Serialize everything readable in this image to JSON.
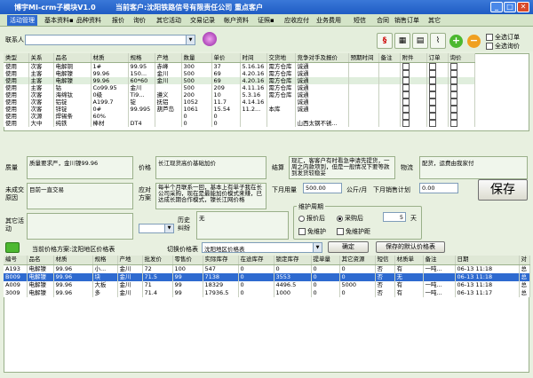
{
  "window": {
    "title": "博宇MI-crm子模块V1.0",
    "customer": "当前客户:沈阳铁路信号有限责任公司 重点客户"
  },
  "menu": [
    "活动管理",
    "基本资料▪",
    "品种资料",
    "报价",
    "询价",
    "其它活动",
    "交易记录",
    "帐户资料",
    "证照▪",
    "应收应付",
    "业务费用",
    "短信",
    "合同",
    "销售订单",
    "其它"
  ],
  "toolbar": {
    "contact_label": "联系人",
    "contact_value": "",
    "all_orders": "全选订单",
    "all_inquiry": "全选询价"
  },
  "grid1": {
    "columns": [
      "类型",
      "关系",
      "品名",
      "材质",
      "规格",
      "产地",
      "数量",
      "单价",
      "时间",
      "交货地",
      "竞争对手及报价",
      "预期时间",
      "备注",
      "附件",
      "订单",
      "询价"
    ],
    "rows": [
      [
        "使用",
        "次客",
        "电解铜",
        "1#",
        "99.95",
        "赤峰",
        "300",
        "37",
        "5.16.16",
        "需方仓库",
        "诚通",
        "",
        "",
        "",
        "",
        ""
      ],
      [
        "使用",
        "主客",
        "电解镍",
        "99.96",
        "150...",
        "金川",
        "500",
        "69",
        "4.20.16",
        "需方仓库",
        "诚通",
        "",
        "",
        "",
        "",
        ""
      ],
      [
        "使用",
        "主客",
        "电解镍",
        "99.96",
        "60*60",
        "金川",
        "500",
        "69",
        "4.20.16",
        "需方仓库",
        "诚通",
        "",
        "",
        "",
        "",
        ""
      ],
      [
        "使用",
        "主客",
        "钴",
        "Co99.95",
        "金川",
        "",
        "500",
        "209",
        "4.11.16",
        "需方仓库",
        "诚通",
        "",
        "",
        "",
        "",
        ""
      ],
      [
        "使用",
        "次客",
        "海绵钛",
        "0级",
        "Ti9...",
        "遵义",
        "200",
        "10",
        "5.3.16",
        "需方仓库",
        "诚通",
        "",
        "",
        "",
        "",
        ""
      ],
      [
        "使用",
        "次客",
        "铝锭",
        "A199.7",
        "锭",
        "抚铝",
        "1052",
        "11.7",
        "4.14.16",
        "",
        "诚通",
        "",
        "",
        "",
        "",
        ""
      ],
      [
        "使用",
        "次客",
        "锌锭",
        "0#",
        "99.995",
        "葫芦岛",
        "1061",
        "15.54",
        "11.2...",
        "本库",
        "诚通",
        "",
        "",
        "",
        "",
        ""
      ],
      [
        "使用",
        "次源",
        "焊锡条",
        "60%",
        "",
        "",
        "0",
        "0",
        "",
        "",
        "",
        "",
        "",
        "",
        "",
        ""
      ],
      [
        "使用",
        "大中",
        "纯铁",
        "棒材",
        "DT4",
        "",
        "0",
        "0",
        "",
        "",
        "山西太钢不锈...",
        "",
        "",
        "",
        "",
        ""
      ]
    ]
  },
  "detail": {
    "quality_label": "质量",
    "quality_value": "质量要求严，金川镍99.96",
    "price_label": "价格",
    "price_value": "长江现货高价基础加价",
    "settle_label": "结算",
    "settle_value": "现汇，客客户有时看急申请先提货，一周之内款项到，但是一般情况下要等款到发货较稳妥",
    "logistics_label": "物流",
    "logistics_value": "配货，运费由我家付",
    "fail_label": "未成交原因",
    "fail_value": "目前一直交易",
    "plan_label": "应对方案",
    "plan_value": "每半个月联系一回，基本上有单子我在长公司采购，现在是最能加价模式来赚，已达成长期合作模式，镍长江网价格",
    "next_month_label": "下月用量",
    "next_month_value": "500.00",
    "unit": "公斤/月",
    "next_plan_label": "下月销售计划",
    "next_plan_value": "0.00",
    "save": "保存",
    "other_label": "其它活动",
    "history_label": "历史纠纷",
    "history_value": "无",
    "maintain_title": "维护周期",
    "maintain_opt1": "报价后",
    "maintain_opt2": "采购后",
    "maintain_days": "5",
    "days_unit": "天",
    "free_maint1": "免维护",
    "free_maint2": "免维护距"
  },
  "pricebar": {
    "current_scheme": "当前价格方案:沈阳地区价格表",
    "switch_label": "切换价格表",
    "switch_value": "沈阳地区价格表",
    "confirm": "确定",
    "save_default": "保存的默认价格表"
  },
  "grid2": {
    "columns": [
      "编号",
      "品名",
      "材质",
      "规格",
      "产地",
      "批发价",
      "零售价",
      "实际库存",
      "在途库存",
      "锁定库存",
      "提单量",
      "其它资源",
      "短信",
      "材质单",
      "备注",
      "日期",
      "对"
    ],
    "rows": [
      [
        "A193",
        "电解镍",
        "99.96",
        "小...",
        "金川",
        "72",
        "100",
        "547",
        "0",
        "0",
        "0",
        "0",
        "否",
        "有",
        "一吨...",
        "06-13 11:18",
        "总"
      ],
      [
        "B009",
        "电解镍",
        "99.96",
        "块",
        "金川",
        "71.5",
        "99",
        "7138",
        "0",
        "3553",
        "0",
        "0",
        "否",
        "无",
        "",
        "06-13 11:18",
        "总"
      ],
      [
        "A009",
        "电解镍",
        "99.96",
        "大板",
        "金川",
        "71",
        "99",
        "18329",
        "0",
        "4496.5",
        "0",
        "5000",
        "否",
        "有",
        "一吨...",
        "06-13 11:18",
        "总"
      ],
      [
        "3009",
        "电解镍",
        "99.96",
        "多",
        "金川",
        "71.4",
        "99",
        "17936.5",
        "0",
        "1000",
        "0",
        "0",
        "否",
        "有",
        "一吨...",
        "06-13 11:17",
        "总"
      ]
    ]
  }
}
